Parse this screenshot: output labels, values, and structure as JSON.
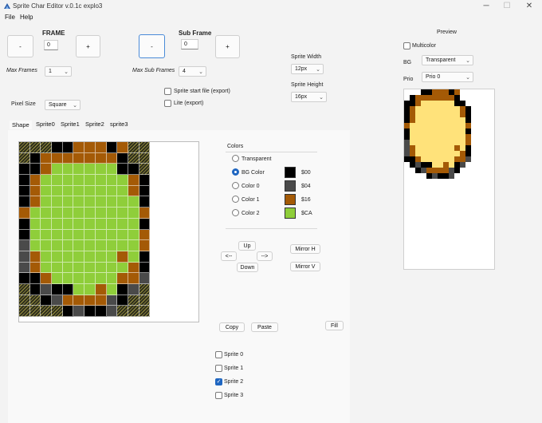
{
  "window": {
    "title": "Sprite Char Editor v.0.1c explo3"
  },
  "menu": {
    "file": "File",
    "help": "Help"
  },
  "frame": {
    "label": "FRAME",
    "value": "0",
    "minus": "-",
    "plus": "+"
  },
  "subframe": {
    "label": "Sub Frame",
    "value": "0",
    "minus": "-",
    "plus": "+"
  },
  "max_frames": {
    "label": "Max Frames",
    "value": "1"
  },
  "max_sub_frames": {
    "label": "Max Sub Frames",
    "value": "4"
  },
  "sprite_width": {
    "label": "Sprite Width",
    "value": "12px"
  },
  "sprite_height": {
    "label": "Sprite Height",
    "value": "16px"
  },
  "options": {
    "start_file": "Sprite start file (export)",
    "lite": "Lite (export)"
  },
  "pixel_size": {
    "label": "Pixel Size",
    "value": "Square"
  },
  "tabs": [
    "Shape",
    "Sprite0",
    "Sprite1",
    "Sprite2",
    "sprite3"
  ],
  "colors": {
    "title": "Colors",
    "transparent": "Transparent",
    "bg": "BG Color",
    "c0": "Color 0",
    "c1": "Color 1",
    "c2": "Color 2",
    "bg_code": "$00",
    "c0_code": "$04",
    "c1_code": "$16",
    "c2_code": "$CA",
    "bg_hex": "#000000",
    "c0_hex": "#4a4a4a",
    "c1_hex": "#a45a06",
    "c2_hex": "#8fce3a"
  },
  "nav": {
    "up": "Up",
    "down": "Down",
    "left": "<--",
    "right": "-->",
    "mirror_h": "Mirror H",
    "mirror_v": "Mirror V"
  },
  "edit": {
    "copy": "Copy",
    "paste": "Paste",
    "fill": "Fill"
  },
  "sprites": [
    "Sprite 0",
    "Sprite 1",
    "Sprite 2",
    "Sprite 3"
  ],
  "preview": {
    "title": "Preview",
    "multicolor": "Multicolor",
    "bg_label": "BG",
    "bg_value": "Transparent",
    "prio_label": "Prio",
    "prio_value": "Prio 0"
  },
  "sprite_pixels": [
    "TTTBBCCCBCTT",
    "TBCCCCCCCBTT",
    "BBCGGGGGGBBT",
    "BCGGGGGGGGCB",
    "BCGGGGGGGGCB",
    "BCGGGGGGGGGB",
    "CGGGGGGGGGGC",
    "BGGGGGGGGGGB",
    "BGGGGGGGGGGC",
    "NGGGGGGGGGGC",
    "NCGGGGGGGCGB",
    "NCGGGGGGGGCB",
    "BBCGGGGGGCCN",
    "TBNBBGGCGBNT",
    "TTBNCCCCNBTT",
    "TTTTBNBBNTTT"
  ],
  "preview_pixels": [
    "TTTBBCCCBCTT",
    "TBCCCCCCCBTT",
    "BBCYYYYYYBBT",
    "BCYYYYYYYYCB",
    "BCYYYYYYYYCB",
    "BCYYYYYYYYYB",
    "CYYYYYYYYYYC",
    "BYYYYYYYYYYB",
    "BYYYYYYYYYYC",
    "NYYYYYYYYYYC",
    "NCYYYYYYYCYB",
    "NCYYYYYYYYCB",
    "BBCYYYYYYCCN",
    "TBNBBYYCYBNT",
    "TTBNCCCCNBTT",
    "TTTTBNBBNTTT"
  ],
  "preview_hex": {
    "Y": "#ffe27a"
  }
}
